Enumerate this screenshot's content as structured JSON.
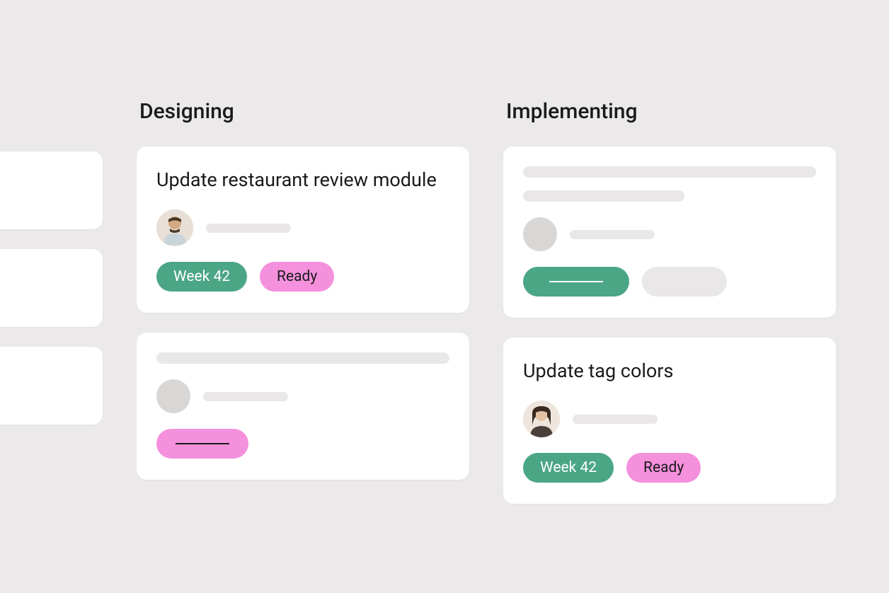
{
  "colors": {
    "background": "#ebe9e9",
    "card": "#ffffff",
    "tag_green": "#4ba686",
    "tag_pink": "#f590dd",
    "placeholder": "#e9e7e7"
  },
  "columns": [
    {
      "id": "prev",
      "title": "",
      "cards": [
        {
          "type": "placeholder"
        },
        {
          "type": "placeholder"
        },
        {
          "type": "placeholder"
        }
      ]
    },
    {
      "id": "designing",
      "title": "Designing",
      "cards": [
        {
          "type": "full",
          "title": "Update restaurant review module",
          "assignee": "user-1",
          "tags": [
            {
              "label": "Week 42",
              "color": "green"
            },
            {
              "label": "Ready",
              "color": "pink"
            }
          ]
        },
        {
          "type": "placeholder_full",
          "tags": [
            {
              "label": "",
              "color": "pink",
              "line": true
            }
          ]
        }
      ]
    },
    {
      "id": "implementing",
      "title": "Implementing",
      "cards": [
        {
          "type": "placeholder_full",
          "tags": [
            {
              "label": "",
              "color": "green",
              "line": true
            },
            {
              "label": "",
              "color": "grey"
            }
          ]
        },
        {
          "type": "full",
          "title": "Update tag colors",
          "assignee": "user-2",
          "tags": [
            {
              "label": "Week 42",
              "color": "green"
            },
            {
              "label": "Ready",
              "color": "pink"
            }
          ]
        }
      ]
    }
  ]
}
